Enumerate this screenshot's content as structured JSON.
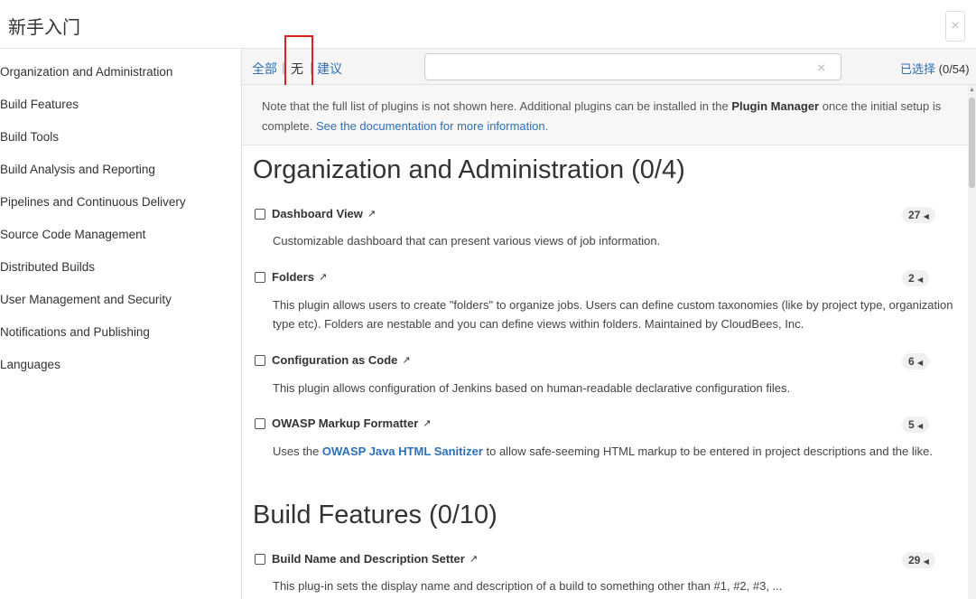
{
  "title": "新手入门",
  "close_icon": "×",
  "sidebar": {
    "items": [
      {
        "label": "Organization and Administration"
      },
      {
        "label": "Build Features"
      },
      {
        "label": "Build Tools"
      },
      {
        "label": "Build Analysis and Reporting"
      },
      {
        "label": "Pipelines and Continuous Delivery"
      },
      {
        "label": "Source Code Management"
      },
      {
        "label": "Distributed Builds"
      },
      {
        "label": "User Management and Security"
      },
      {
        "label": "Notifications and Publishing"
      },
      {
        "label": "Languages"
      }
    ]
  },
  "toolbar": {
    "filter_all": "全部",
    "filter_none": "无",
    "filter_suggested": "建议",
    "separator": "|",
    "search_value": "",
    "search_clear": "×",
    "selected_label": "已选择",
    "selected_count": "(0/54)"
  },
  "note": {
    "text_before": "Note that the full list of plugins is not shown here. Additional plugins can be installed in the ",
    "bold": "Plugin Manager",
    "text_after": " once the initial setup is complete. ",
    "link": "See the documentation for more information."
  },
  "sections": [
    {
      "title": "Organization and Administration (0/4)",
      "plugins": [
        {
          "name": "Dashboard View",
          "badge": "27",
          "desc": "Customizable dashboard that can present various views of job information."
        },
        {
          "name": "Folders",
          "badge": "2",
          "desc": "This plugin allows users to create \"folders\" to organize jobs. Users can define custom taxonomies (like by project type, organization type etc). Folders are nestable and you can define views within folders. Maintained by CloudBees, Inc."
        },
        {
          "name": "Configuration as Code",
          "badge": "6",
          "desc": "This plugin allows configuration of Jenkins based on human-readable declarative configuration files."
        },
        {
          "name": "OWASP Markup Formatter",
          "badge": "5",
          "desc_before": "Uses the ",
          "desc_link": "OWASP Java HTML Sanitizer",
          "desc_after": " to allow safe-seeming HTML markup to be entered in project descriptions and the like."
        }
      ]
    },
    {
      "title": "Build Features (0/10)",
      "plugins": [
        {
          "name": "Build Name and Description Setter",
          "badge": "29",
          "desc": "This plug-in sets the display name and description of a build to something other than #1, #2, #3, ..."
        }
      ]
    }
  ],
  "icons": {
    "external": "↗",
    "badge_arrow": "◀",
    "scroll_up": "▲"
  },
  "colors": {
    "link": "#2f6fb8",
    "highlight": "#e02020"
  }
}
